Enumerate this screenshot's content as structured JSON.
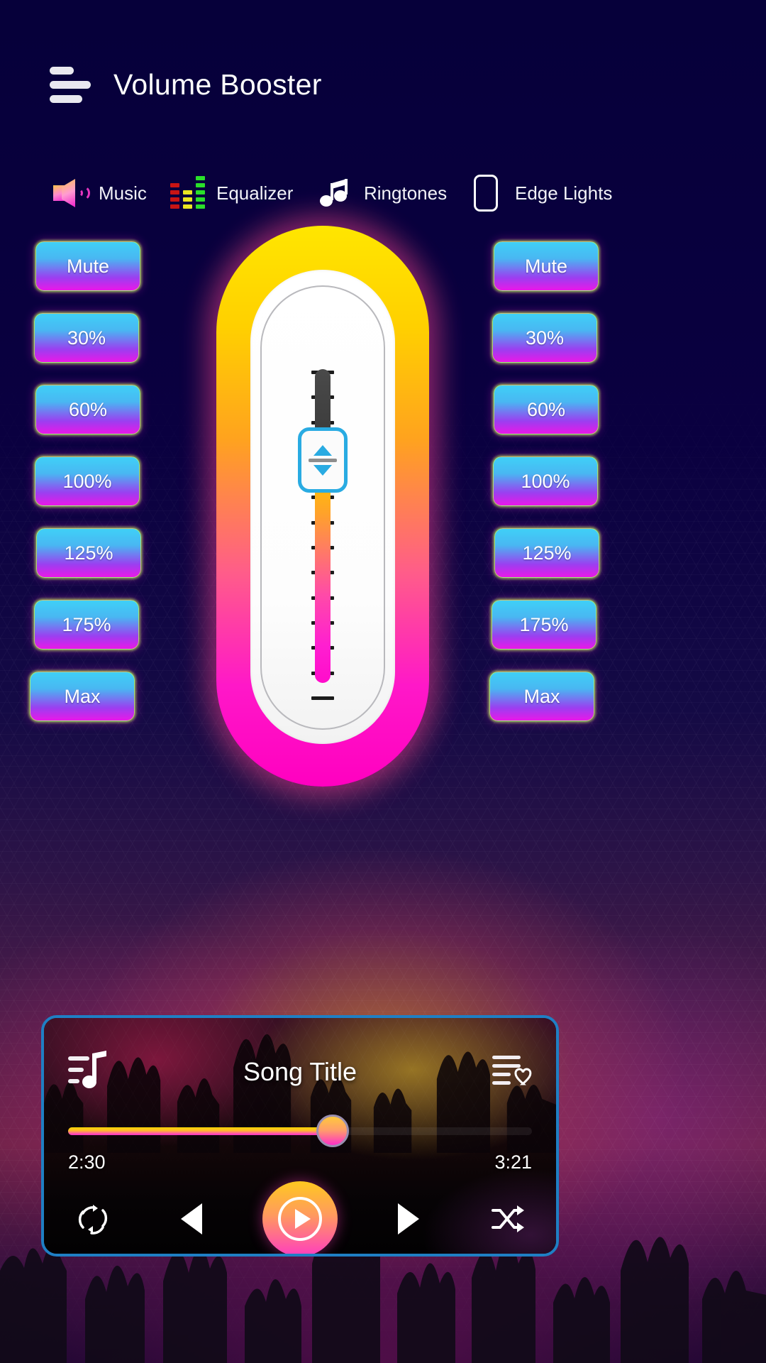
{
  "header": {
    "title": "Volume Booster",
    "menu_icon": "hamburger-menu-icon"
  },
  "nav": {
    "items": [
      {
        "label": "Music",
        "icon": "speaker-volume-icon"
      },
      {
        "label": "Equalizer",
        "icon": "equalizer-bars-icon"
      },
      {
        "label": "Ringtones",
        "icon": "music-notes-icon"
      },
      {
        "label": "Edge Lights",
        "icon": "phone-outline-icon"
      }
    ]
  },
  "volume_presets": {
    "left": [
      "Mute",
      "30%",
      "60%",
      "100%",
      "125%",
      "175%",
      "Max"
    ],
    "right": [
      "Mute",
      "30%",
      "60%",
      "100%",
      "125%",
      "175%",
      "Max"
    ]
  },
  "slider": {
    "name": "volume-slider",
    "thumb_up_icon": "triangle-up-icon",
    "thumb_down_icon": "triangle-down-icon",
    "tick_count": 14,
    "fill_percent": 78,
    "thumb_percent": 22,
    "colors": {
      "shell_top": "#ffe600",
      "shell_bottom": "#ff00c0",
      "thumb_border": "#29abe2"
    }
  },
  "player": {
    "song_title": "Song Title",
    "playlist_icon": "playlist-note-icon",
    "favorites_icon": "playlist-heart-icon",
    "current_time": "2:30",
    "total_time": "3:21",
    "progress_percent": 57,
    "controls": [
      {
        "name": "repeat-button",
        "icon": "repeat-icon"
      },
      {
        "name": "previous-button",
        "icon": "previous-triangle-icon"
      },
      {
        "name": "play-button",
        "icon": "play-circle-icon"
      },
      {
        "name": "next-button",
        "icon": "next-triangle-icon"
      },
      {
        "name": "shuffle-button",
        "icon": "shuffle-icon"
      }
    ]
  },
  "theme": {
    "background": "#06003a",
    "accent_blue": "#29abe2",
    "accent_pink": "#ff00c0",
    "accent_yellow": "#ffe600",
    "button_gradient_top": "#3fd0f7",
    "button_gradient_bottom": "#e918e8",
    "card_border": "#1f7fc4"
  }
}
